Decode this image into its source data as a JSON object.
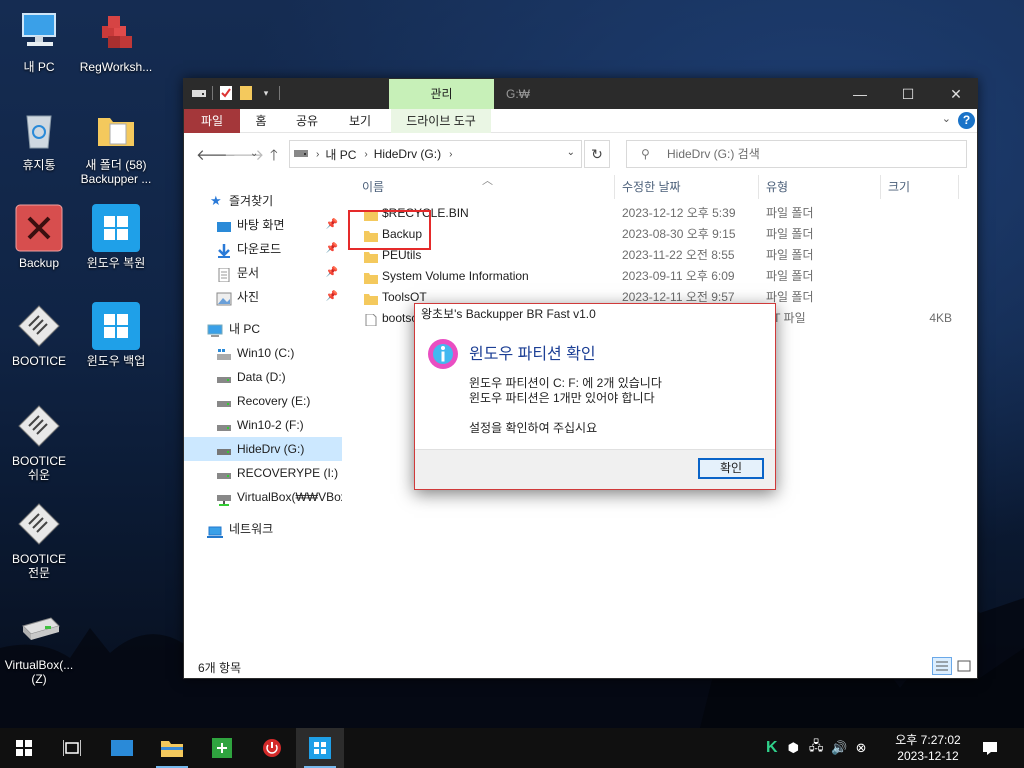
{
  "desktop": {
    "icons": [
      {
        "label_lines": [
          "내 PC"
        ]
      },
      {
        "label_lines": [
          "RegWorksh..."
        ]
      },
      {
        "label_lines": [
          "휴지통"
        ]
      },
      {
        "label_lines": [
          "새 폴더 (58)",
          "Backupper ..."
        ]
      },
      {
        "label_lines": [
          "Backup"
        ]
      },
      {
        "label_lines": [
          "윈도우 복원"
        ]
      },
      {
        "label_lines": [
          "BOOTICE"
        ]
      },
      {
        "label_lines": [
          "윈도우 백업"
        ]
      },
      {
        "label_lines": [
          "BOOTICE",
          "쉬운"
        ]
      },
      {
        "label_lines": [
          "BOOTICE",
          "전문"
        ]
      },
      {
        "label_lines": [
          "VirtualBox(...",
          "(Z)"
        ]
      }
    ]
  },
  "explorer": {
    "manage_tab": "관리",
    "title": "G:₩",
    "ribbon_tabs": [
      "파일",
      "홈",
      "공유",
      "보기",
      "드라이브 도구"
    ],
    "address": {
      "root": "내 PC",
      "current": "HideDrv (G:)"
    },
    "search_placeholder": "HideDrv (G:) 검색",
    "nav": {
      "quick_access": "즐겨찾기",
      "quick_items": [
        "바탕 화면",
        "다운로드",
        "문서",
        "사진"
      ],
      "this_pc": "내 PC",
      "drives": [
        "Win10 (C:)",
        "Data (D:)",
        "Recovery (E:)",
        "Win10-2 (F:)",
        "HideDrv (G:)",
        "RECOVERYPE (I:)",
        "VirtualBox(₩₩VBox"
      ],
      "network": "네트워크"
    },
    "columns": {
      "name": "이름",
      "date": "수정한 날짜",
      "type": "유형",
      "size": "크기"
    },
    "files": [
      {
        "name": "$RECYCLE.BIN",
        "date": "2023-12-12 오후 5:39",
        "type": "파일 폴더",
        "size": ""
      },
      {
        "name": "Backup",
        "date": "2023-08-30 오후 9:15",
        "type": "파일 폴더",
        "size": ""
      },
      {
        "name": "PEUtils",
        "date": "2023-11-22 오전 8:55",
        "type": "파일 폴더",
        "size": ""
      },
      {
        "name": "System Volume Information",
        "date": "2023-09-11 오후 6:09",
        "type": "파일 폴더",
        "size": ""
      },
      {
        "name": "ToolsOT",
        "date": "2023-12-11 오전 9:57",
        "type": "파일 폴더",
        "size": ""
      },
      {
        "name": "bootsc",
        "date": "",
        "type": "AT 파일",
        "size": "4KB"
      }
    ],
    "status": "6개 항목"
  },
  "dialog": {
    "title": "왕초보's Backupper BR Fast v1.0",
    "heading": "윈도우 파티션 확인",
    "lines": [
      "윈도우 파티션이  C: F: 에 2개 있습니다",
      "윈도우 파티션은 1개만 있어야 합니다",
      "설정을 확인하여 주십시요"
    ],
    "ok_label": "확인"
  },
  "taskbar": {
    "clock_time": "오후 7:27:02",
    "clock_date": "2023-12-12"
  }
}
